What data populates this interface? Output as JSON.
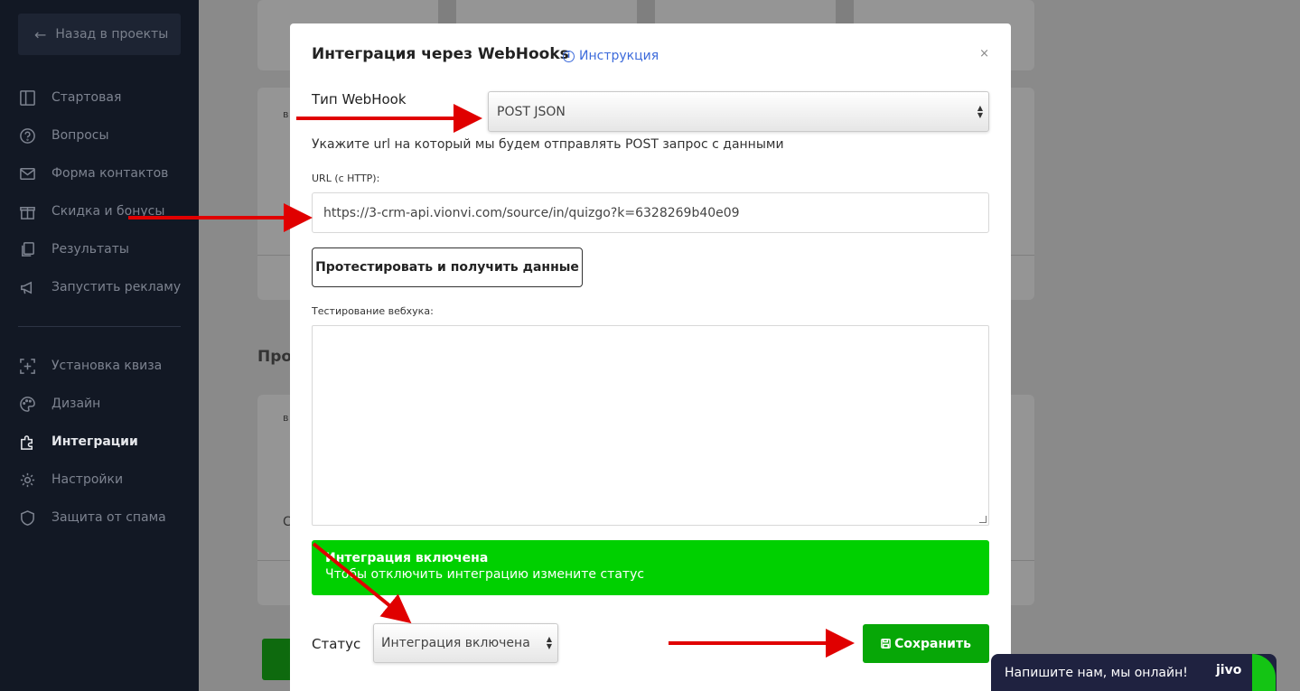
{
  "sidebar": {
    "back_label": "Назад в проекты",
    "items": [
      {
        "label": "Стартовая",
        "icon": "layout-icon"
      },
      {
        "label": "Вопросы",
        "icon": "question-icon"
      },
      {
        "label": "Форма контактов",
        "icon": "mail-icon"
      },
      {
        "label": "Скидка и бонусы",
        "icon": "gift-icon"
      },
      {
        "label": "Результаты",
        "icon": "results-icon"
      },
      {
        "label": "Запустить рекламу",
        "icon": "megaphone-icon"
      },
      {
        "label": "Установка квиза",
        "icon": "install-icon"
      },
      {
        "label": "Дизайн",
        "icon": "palette-icon"
      },
      {
        "label": "Интеграции",
        "icon": "puzzle-icon",
        "active": true
      },
      {
        "label": "Настройки",
        "icon": "gear-icon"
      },
      {
        "label": "Защита от спама",
        "icon": "shield-icon"
      }
    ]
  },
  "background": {
    "section_title_partial": "Про",
    "small_label_1": "в",
    "small_label_2": "в",
    "small_label_3": "С"
  },
  "modal": {
    "title": "Интеграция через WebHooks",
    "instruction_link": "Инструкция",
    "close": "×",
    "type_label": "Тип WebHook",
    "type_value": "POST JSON",
    "hint": "Укажите url на который мы будем отправлять POST запрос с данными",
    "url_label": "URL (с HTTP):",
    "url_value": "https://3-crm-api.vionvi.com/source/in/quizgo?k=6328269b40e09",
    "test_button": "Протестировать и получить данные",
    "testing_label": "Тестирование вебхука:",
    "testing_value": "",
    "alert_title": "Интеграция включена",
    "alert_text": "Чтобы отключить интеграцию измените статус",
    "status_label": "Статус",
    "status_value": "Интеграция включена",
    "save_button": "Сохранить"
  },
  "chat": {
    "message": "Напишите нам, мы онлайн!",
    "logo": "jivo"
  },
  "colors": {
    "sidebar_bg": "#121824",
    "accent_link": "#3d6bdb",
    "alert_green": "#00d000",
    "save_green": "#07a707",
    "annotation_red": "#e00000"
  }
}
